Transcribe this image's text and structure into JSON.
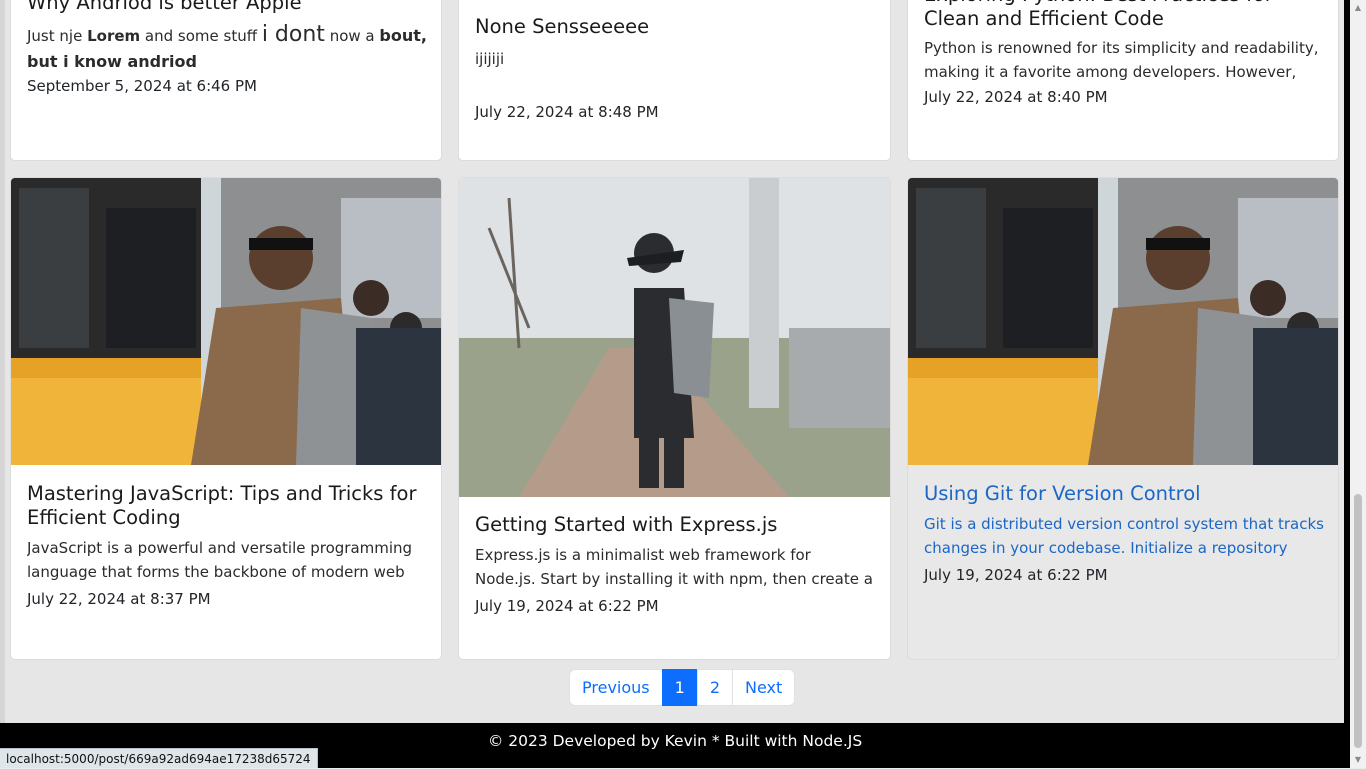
{
  "top_cards": [
    {
      "title": "Why Andriod is better Apple",
      "body_parts": [
        {
          "text": "Just nje ",
          "style": "normal"
        },
        {
          "text": "Lorem",
          "style": "bold"
        },
        {
          "text": " and some stuff ",
          "style": "normal"
        },
        {
          "text": "i dont",
          "style": "large"
        },
        {
          "text": " now a ",
          "style": "normal"
        },
        {
          "text": "bout, but i know andriod",
          "style": "boldlarge"
        }
      ],
      "date": "September 5, 2024 at 6:46 PM"
    },
    {
      "title": "None Sensseeeee",
      "body": "ijijiji",
      "date": "July 22, 2024 at 8:48 PM"
    },
    {
      "title": "Exploring Python: Best Practices for Clean and Efficient Code",
      "body": "Python is renowned for its simplicity and readability, making it a favorite among developers. However, writing clean and efficient code requires ...",
      "date": "July 22, 2024 at 8:40 PM"
    }
  ],
  "bottom_cards": [
    {
      "image": "man-by-yellow-tram-photo",
      "title": "Mastering JavaScript: Tips and Tricks for Efficient Coding",
      "body": "JavaScript is a powerful and versatile programming language that forms the backbone of modern web development. Here are some tips...",
      "date": "July 22, 2024 at 8:37 PM"
    },
    {
      "image": "man-with-backpack-street-photo",
      "title": "Getting Started with Express.js",
      "body": "Express.js is a minimalist web framework for Node.js. Start by installing it with npm, then create a basic server using app.get() to define routes and middleware...",
      "date": "July 19, 2024 at 6:22 PM"
    },
    {
      "image": "man-by-yellow-tram-photo",
      "title": "Using Git for Version Control",
      "body": "Git is a distributed version control system that tracks changes in your codebase. Initialize a repository with git init, stage changes with git add and commit...",
      "date": "July 19, 2024 at 6:22 PM"
    }
  ],
  "pagination": {
    "previous": "Previous",
    "pages": [
      "1",
      "2"
    ],
    "active": "1",
    "next": "Next"
  },
  "footer": {
    "text": "© 2023 Developed by Kevin * Built with Node.JS"
  },
  "status_bar": {
    "url": "localhost:5000/post/669a92ad694ae17238d65724"
  },
  "colors": {
    "link": "#1c66c6",
    "active_page": "#0d6efd",
    "footer_bg": "#000000"
  }
}
